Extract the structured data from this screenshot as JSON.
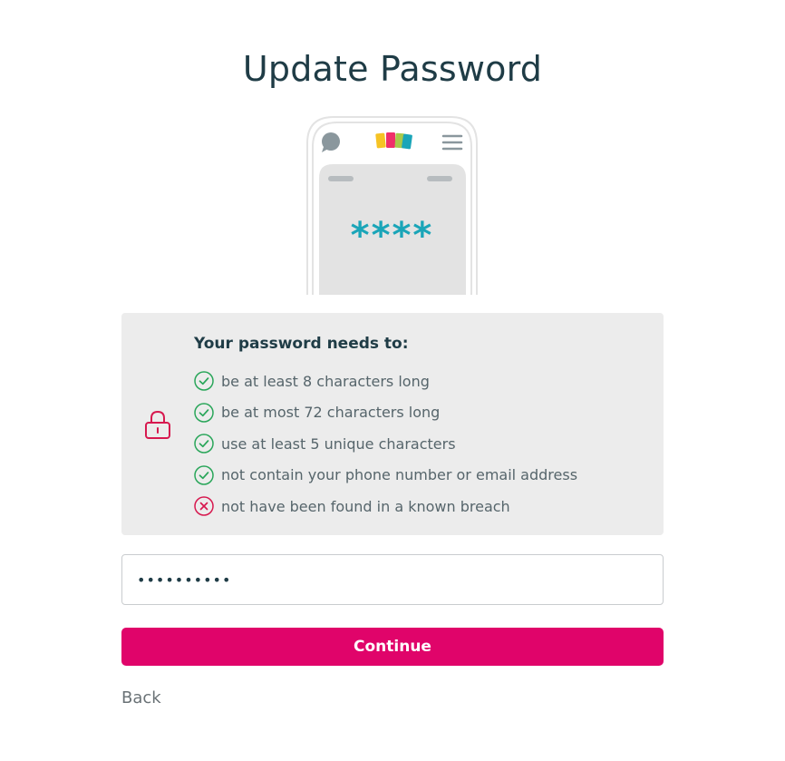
{
  "header": {
    "title": "Update Password"
  },
  "illustration": {
    "masked_text": "****",
    "icons": [
      "chat-bubble-icon",
      "logo-icon",
      "hamburger-menu-icon"
    ],
    "logo_colors": [
      "#f6c324",
      "#ef2f6a",
      "#1aa5b8"
    ]
  },
  "requirements": {
    "title": "Your password needs to:",
    "icon": "lock-icon",
    "items": [
      {
        "text": "be at least 8 characters long",
        "status": "pass"
      },
      {
        "text": "be at most 72 characters long",
        "status": "pass"
      },
      {
        "text": "use at least 5 unique characters",
        "status": "pass"
      },
      {
        "text": "not contain your phone number or email address",
        "status": "pass"
      },
      {
        "text": "not have been found in a known breach",
        "status": "fail"
      }
    ]
  },
  "password_field": {
    "value": "••••••••••",
    "type": "password"
  },
  "actions": {
    "continue_label": "Continue",
    "back_label": "Back"
  },
  "colors": {
    "accent": "#e0046a",
    "pass": "#2aa65a",
    "fail": "#d7194f",
    "panel": "#ececec",
    "text_dark": "#1f3c46"
  }
}
